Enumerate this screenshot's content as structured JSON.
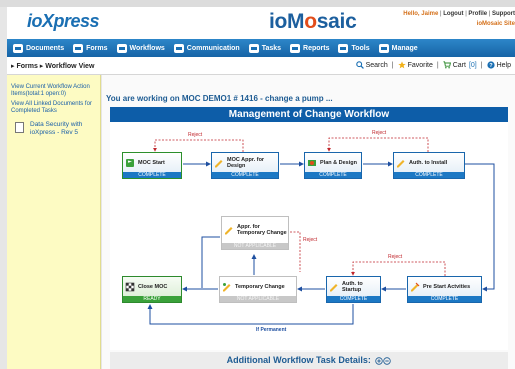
{
  "header": {
    "logo_left_prefix": "io",
    "logo_left_main": "Xpress",
    "logo_center_prefix": "ioM",
    "logo_center_accent": "o",
    "logo_center_suffix": "saic",
    "hello": "Hello, Jaime",
    "logout": "Logout",
    "profile": "Profile",
    "support": "Support",
    "site": "ioMosaic Site"
  },
  "nav": [
    {
      "label": "Documents",
      "icon": "documents-icon"
    },
    {
      "label": "Forms",
      "icon": "forms-icon"
    },
    {
      "label": "Workflows",
      "icon": "workflows-icon"
    },
    {
      "label": "Communication",
      "icon": "communication-icon"
    },
    {
      "label": "Tasks",
      "icon": "tasks-icon"
    },
    {
      "label": "Reports",
      "icon": "reports-icon"
    },
    {
      "label": "Tools",
      "icon": "tools-icon"
    },
    {
      "label": "Manage",
      "icon": "manage-icon"
    }
  ],
  "breadcrumb": "▸ Forms ▸ Workflow View",
  "tools": {
    "search": "Search",
    "favorite": "Favorite",
    "cart": "Cart",
    "cart_count": "[0]",
    "help": "Help"
  },
  "sidebar": {
    "link1": "View Current Workflow Action Items(total:1 open:0)",
    "link2": "View All Linked Documents for Completed Tasks",
    "doc_title": "Data Security with ioXpress - Rev 5"
  },
  "main": {
    "working_on": "You are working on MOC DEMO1 # 1416 - change a pump ...",
    "workflow_title": "Management of Change Workflow",
    "additional": "Additional Workflow Task Details:"
  },
  "workflow": {
    "nodes": {
      "moc_start": {
        "label": "MOC Start",
        "status": "COMPLETE"
      },
      "moc_appr": {
        "label": "MOC Appr. for Design",
        "status": "COMPLETE"
      },
      "plan_design": {
        "label": "Plan & Design",
        "status": "COMPLETE"
      },
      "auth_install": {
        "label": "Auth. to Install",
        "status": "COMPLETE"
      },
      "appr_temp": {
        "label": "Appr. for Temporary Change",
        "status": "NOT APPLICABLE"
      },
      "temp_change": {
        "label": "Temporary Change",
        "status": "NOT APPLICABLE"
      },
      "auth_startup": {
        "label": "Auth. to Startup",
        "status": "COMPLETE"
      },
      "pre_start": {
        "label": "Pre Start Actvities",
        "status": "COMPLETE"
      },
      "close_moc": {
        "label": "Close MOC",
        "status": "READY"
      }
    },
    "edges": {
      "reject": "Reject",
      "if_permanent": "If Permanent"
    }
  },
  "colors": {
    "nav_blue": "#1664a6",
    "title_blue": "#0d5da8",
    "reject_red": "#c0262c",
    "sidebar_yellow": "#fdfbc3"
  }
}
